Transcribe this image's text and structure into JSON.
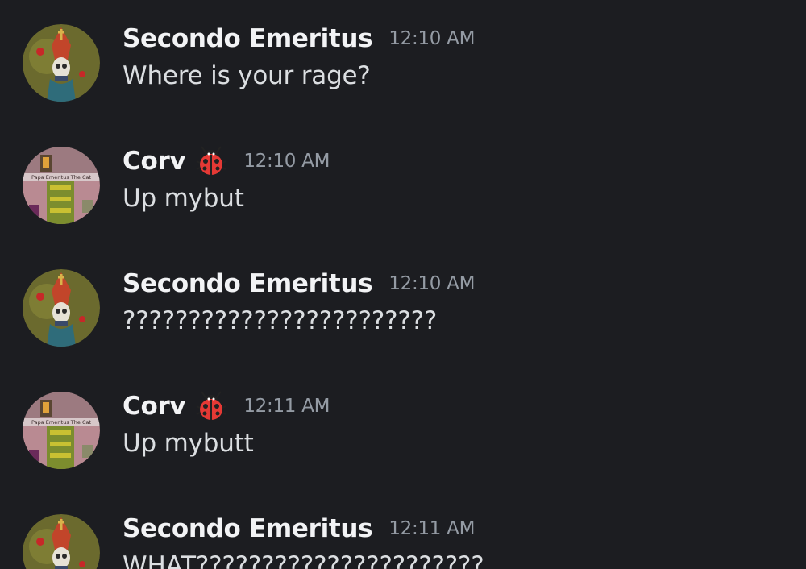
{
  "messages": [
    {
      "author": "Secondo Emeritus",
      "avatar": "papa-avatar",
      "badge": null,
      "time": "12:10 AM",
      "content": "Where is your rage?"
    },
    {
      "author": "Corv",
      "avatar": "minecraft-avatar",
      "badge": "ladybug-icon",
      "time": "12:10 AM",
      "content": "Up mybut"
    },
    {
      "author": "Secondo Emeritus",
      "avatar": "papa-avatar",
      "badge": null,
      "time": "12:10 AM",
      "content": "????????????????????????"
    },
    {
      "author": "Corv",
      "avatar": "minecraft-avatar",
      "badge": "ladybug-icon",
      "time": "12:11 AM",
      "content": "Up mybutt"
    },
    {
      "author": "Secondo Emeritus",
      "avatar": "papa-avatar",
      "badge": null,
      "time": "12:11 AM",
      "content": "WHAT??????????????????????"
    }
  ],
  "avatar_caption": "Papa Emeritus The Cat",
  "colors": {
    "background": "#1c1d21",
    "author": "#f2f3f5",
    "timestamp": "#949ba4",
    "content": "#dbdee1"
  }
}
